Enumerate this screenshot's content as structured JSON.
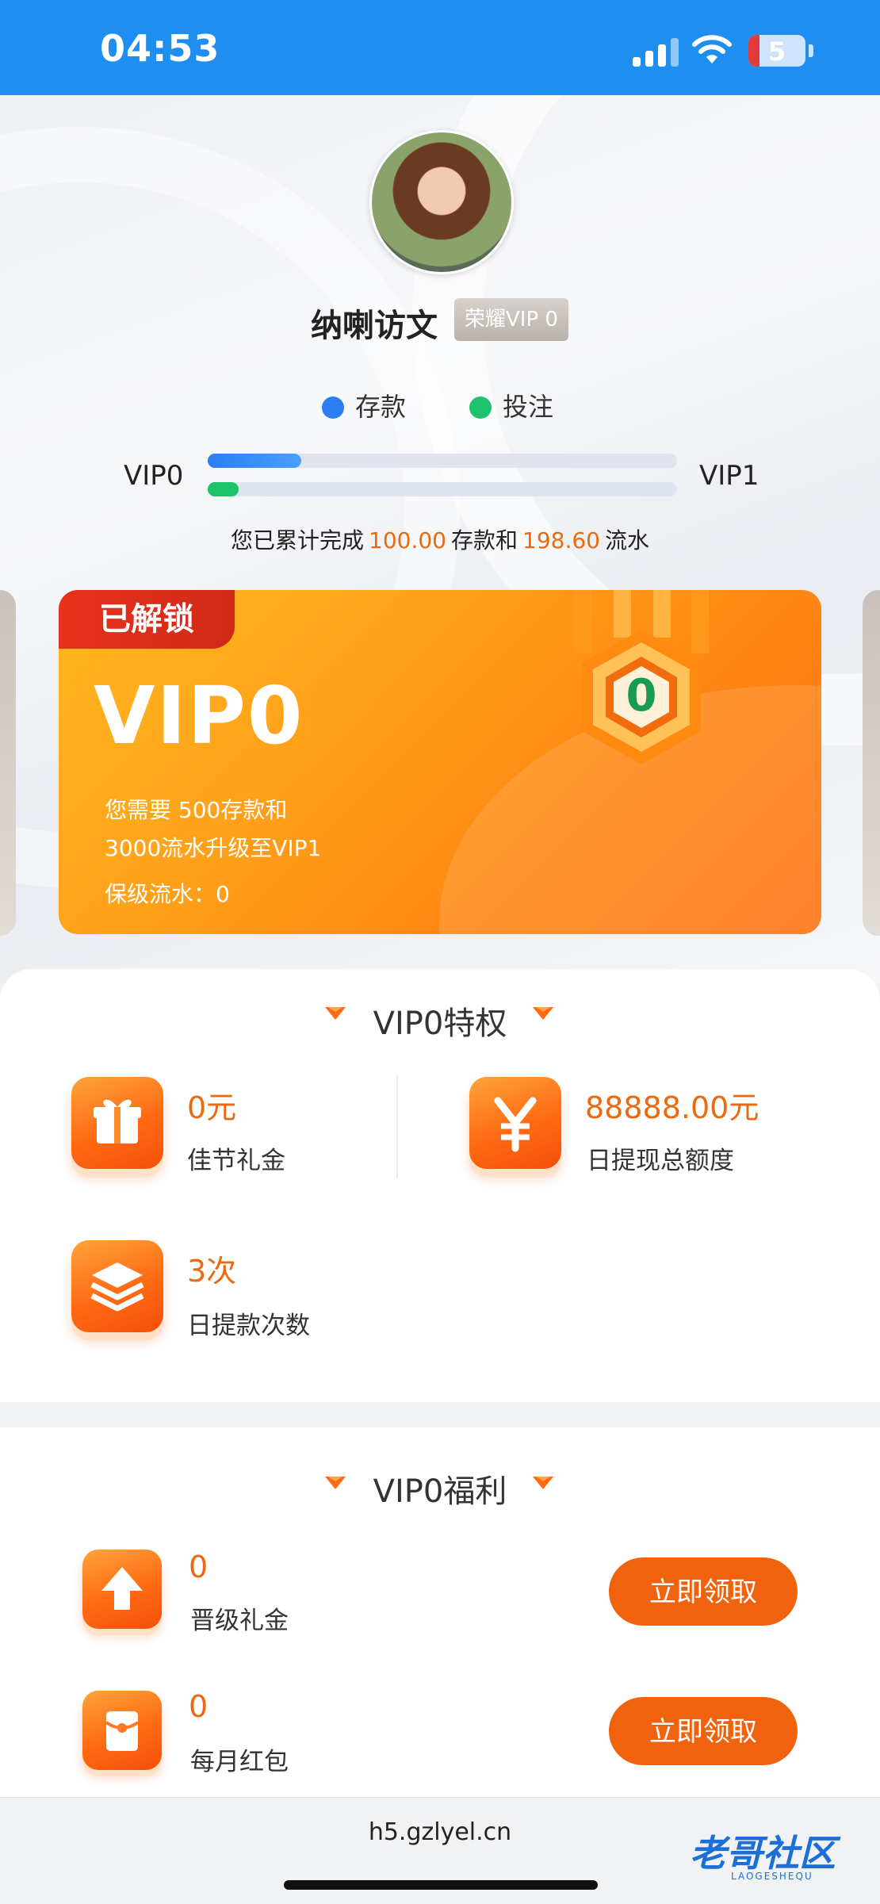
{
  "status_bar": {
    "time": "04:53",
    "battery": "5"
  },
  "profile": {
    "name": "纳喇访文",
    "badge": "荣耀VIP 0"
  },
  "legend": {
    "deposit": "存款",
    "bet": "投注",
    "deposit_color": "#2b7ff2",
    "bet_color": "#1dc36a"
  },
  "progress": {
    "current_level": "VIP0",
    "next_level": "VIP1",
    "deposit_fraction": 0.2,
    "bet_fraction": 0.066,
    "text_prefix": "您已累计完成",
    "deposit_amount": "100.00",
    "text_middle": "存款和",
    "bet_amount": "198.60",
    "text_suffix": "流水"
  },
  "vip_card": {
    "tag": "已解锁",
    "title": "VIP0",
    "line1": "您需要  500存款和",
    "line2": "3000流水升级至VIP1",
    "line3": "保级流水：0",
    "medal_level": "0"
  },
  "privileges": {
    "title": "VIP0特权",
    "items": [
      {
        "value": "0元",
        "label": "佳节礼金",
        "icon": "gift-icon"
      },
      {
        "value": "88888.00元",
        "label": "日提现总额度",
        "icon": "yen-icon"
      },
      {
        "value": "3次",
        "label": "日提款次数",
        "icon": "layers-icon"
      }
    ]
  },
  "benefits": {
    "title": "VIP0福利",
    "items": [
      {
        "value": "0",
        "label": "晋级礼金",
        "button": "立即领取",
        "icon": "arrow-up-icon"
      },
      {
        "value": "0",
        "label": "每月红包",
        "button": "立即领取",
        "icon": "red-packet-icon"
      }
    ]
  },
  "browser": {
    "url": "h5.gzlyel.cn"
  },
  "watermark": {
    "text": "老哥社区",
    "sub": "LAOGESHEQU"
  },
  "colors": {
    "accent": "#f0620d",
    "value_orange": "#ea6a10",
    "status_blue": "#1e8ef0"
  }
}
